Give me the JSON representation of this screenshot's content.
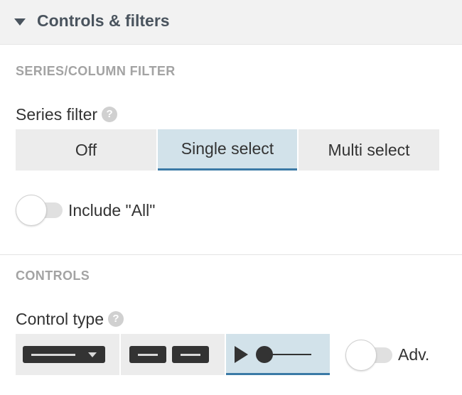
{
  "header": {
    "title": "Controls & filters",
    "icon": "caret-down-icon"
  },
  "series_section": {
    "title": "SERIES/COLUMN FILTER",
    "filter_label": "Series filter",
    "help": "?",
    "options": [
      "Off",
      "Single select",
      "Multi select"
    ],
    "selected": "Single select",
    "include_all_label": "Include \"All\"",
    "include_all_on": false
  },
  "controls_section": {
    "title": "CONTROLS",
    "control_type_label": "Control type",
    "help": "?",
    "control_types": [
      "dropdown-control-icon",
      "buttons-control-icon",
      "slider-control-icon"
    ],
    "selected_control": "slider-control-icon",
    "adv_label": "Adv.",
    "adv_on": false
  },
  "colors": {
    "active_tab_bg": "#d2e2ea",
    "active_tab_border": "#3b7aa6",
    "icon_dark": "#333333"
  }
}
